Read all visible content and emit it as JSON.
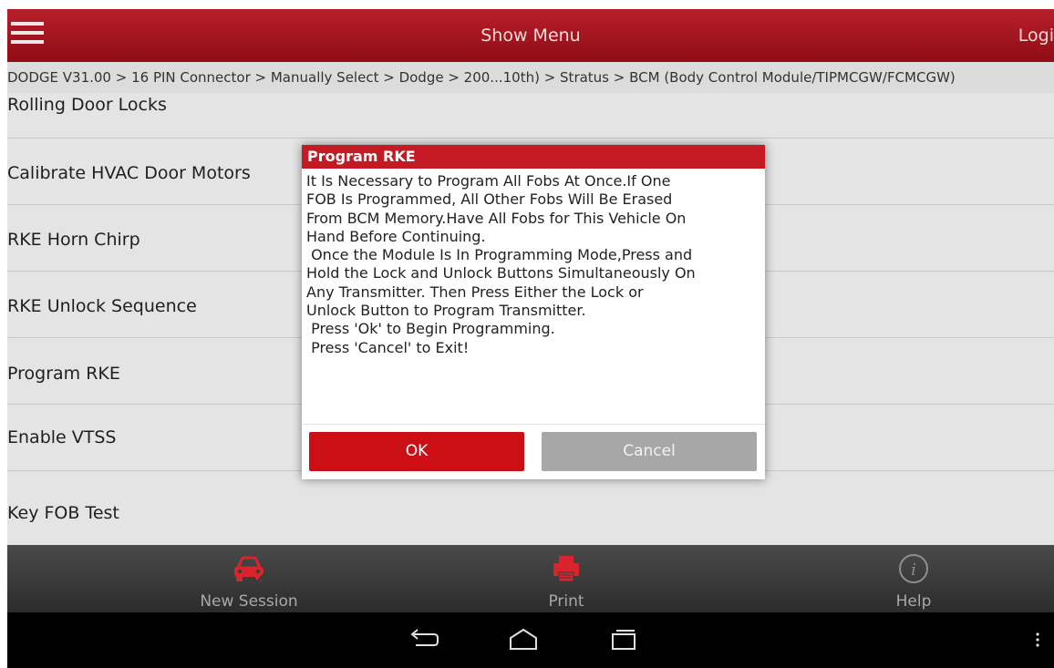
{
  "topbar": {
    "title": "Show Menu",
    "login": "Logi"
  },
  "breadcrumb": "DODGE V31.00 > 16 PIN Connector > Manually Select > Dodge > 200...10th) > Stratus > BCM (Body Control Module/TIPMCGW/FCMCGW)",
  "list": {
    "items": [
      "Rolling Door Locks",
      "Calibrate HVAC Door Motors",
      "RKE Horn Chirp",
      "RKE Unlock Sequence",
      "Program RKE",
      "Enable VTSS",
      "Key FOB Test"
    ]
  },
  "dialog": {
    "title": "Program RKE",
    "lines": [
      "It Is Necessary to Program All Fobs At Once.If One",
      "FOB Is Programmed, All Other Fobs Will Be Erased",
      "From BCM Memory.Have All Fobs for This Vehicle On",
      "Hand Before Continuing.",
      " Once the Module Is In Programming Mode,Press and",
      "Hold the Lock and Unlock Buttons Simultaneously On",
      "Any Transmitter. Then Press Either the Lock or",
      "Unlock Button to Program Transmitter.",
      " Press 'Ok' to Begin Programming.",
      " Press 'Cancel' to Exit!"
    ],
    "ok_label": "OK",
    "cancel_label": "Cancel"
  },
  "bottombar": {
    "new_session": "New Session",
    "print": "Print",
    "help": "Help"
  },
  "colors": {
    "brand_red": "#b81f2a",
    "dialog_header": "#c41a24",
    "ok_button": "#cc0f14",
    "cancel_button": "#a7a7a7"
  },
  "icons": {
    "menu": "hamburger-menu-icon",
    "new_session": "car-icon",
    "print": "printer-icon",
    "help": "info-icon",
    "back": "back-icon",
    "home": "home-icon",
    "recents": "recent-apps-icon",
    "overflow": "overflow-menu-icon"
  }
}
